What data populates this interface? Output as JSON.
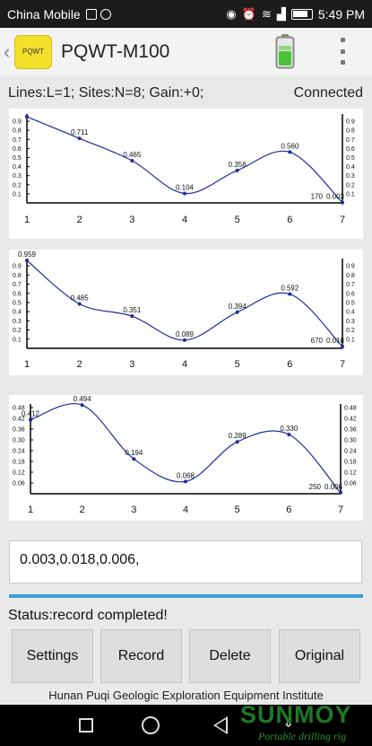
{
  "status_bar": {
    "carrier": "China Mobile",
    "time": "5:49 PM"
  },
  "app": {
    "title": "PQWT-M100",
    "logo_text": "PQWT"
  },
  "info": {
    "params": "Lines:L=1;  Sites:N=8;  Gain:+0;",
    "connection": "Connected"
  },
  "result_value": "0.003,0.018,0.006,",
  "status_text": "Status:record completed!",
  "buttons": {
    "settings": "Settings",
    "record": "Record",
    "delete": "Delete",
    "original": "Original"
  },
  "footer": "Hunan Puqi Geologic Exploration Equipment Institute",
  "watermark": {
    "brand": "SUNMOY",
    "tagline": "Portable drilling rig"
  },
  "colors": {
    "line": "#1c2c9c",
    "accent": "#3a9fd8"
  },
  "chart_data": [
    {
      "type": "line",
      "x": [
        1,
        2,
        3,
        4,
        5,
        6,
        7
      ],
      "values": [
        0.95,
        0.711,
        0.465,
        0.104,
        0.358,
        0.56,
        0.003
      ],
      "point_labels": [
        "",
        "0.711",
        "0.465",
        "0.104",
        "0.358",
        "0.560",
        "0.003"
      ],
      "end_note": "170",
      "y_ticks": [
        "0.9",
        "0.8",
        "0.7",
        "0.6",
        "0.5",
        "0.4",
        "0.3",
        "0.2",
        "0.1"
      ],
      "y_tick_values": [
        0.9,
        0.8,
        0.7,
        0.6,
        0.5,
        0.4,
        0.3,
        0.2,
        0.1
      ],
      "ylim": [
        0,
        0.98
      ]
    },
    {
      "type": "line",
      "x": [
        1,
        2,
        3,
        4,
        5,
        6,
        7
      ],
      "values": [
        0.959,
        0.485,
        0.351,
        0.089,
        0.394,
        0.592,
        0.018
      ],
      "point_labels": [
        "0.959",
        "0.485",
        "0.351",
        "0.089",
        "0.394",
        "0.592",
        "0.018"
      ],
      "end_note": "670",
      "y_ticks": [
        "0.9",
        "0.8",
        "0.7",
        "0.6",
        "0.5",
        "0.4",
        "0.3",
        "0.2",
        "0.1"
      ],
      "y_tick_values": [
        0.9,
        0.8,
        0.7,
        0.6,
        0.5,
        0.4,
        0.3,
        0.2,
        0.1
      ],
      "ylim": [
        0,
        0.98
      ]
    },
    {
      "type": "line",
      "x": [
        1,
        2,
        3,
        4,
        5,
        6,
        7
      ],
      "values": [
        0.412,
        0.494,
        0.194,
        0.068,
        0.289,
        0.33,
        0.006
      ],
      "point_labels": [
        "0.412",
        "0.494",
        "0.194",
        "0.068",
        "0.289",
        "0.330",
        "0.006"
      ],
      "end_note": "250",
      "y_ticks": [
        "0.48",
        "0.42",
        "0.36",
        "0.30",
        "0.24",
        "0.18",
        "0.12",
        "0.06"
      ],
      "y_tick_values": [
        0.48,
        0.42,
        0.36,
        0.3,
        0.24,
        0.18,
        0.12,
        0.06
      ],
      "ylim": [
        0,
        0.5
      ]
    }
  ]
}
